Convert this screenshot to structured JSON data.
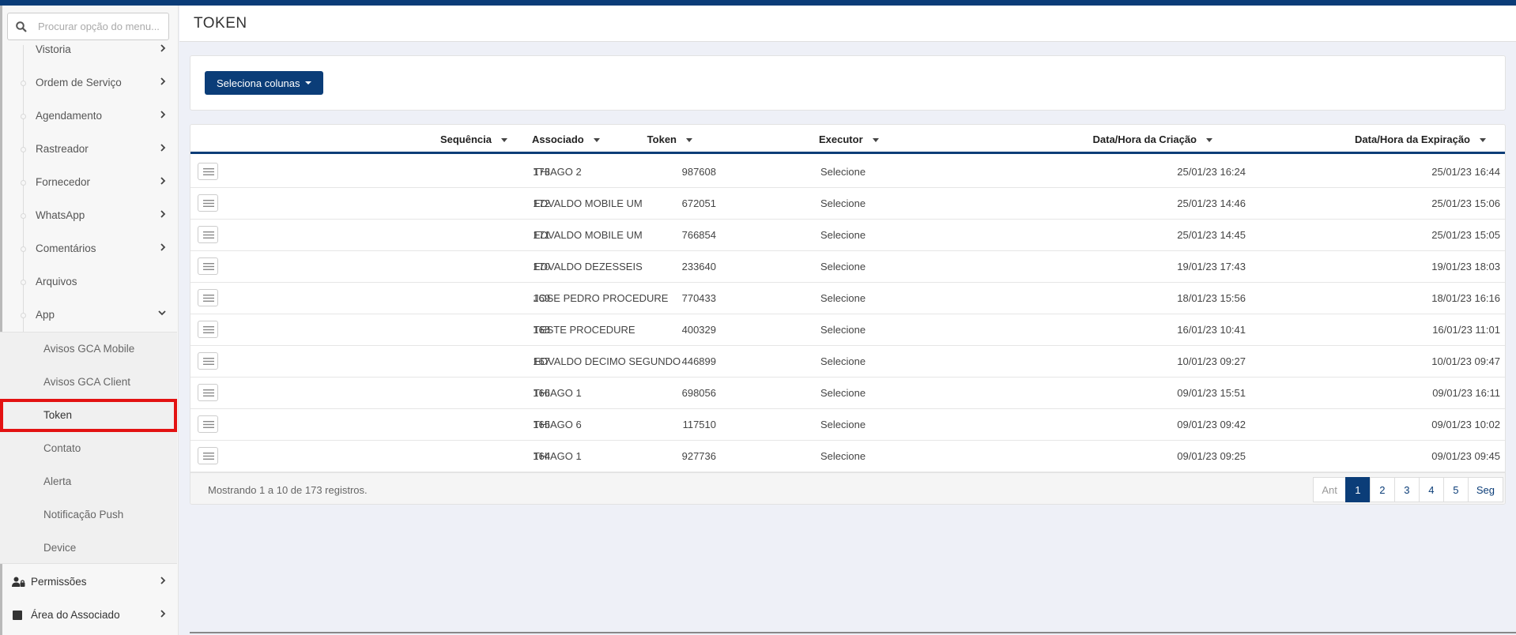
{
  "sidebar": {
    "search_placeholder": "Procurar opção do menu...",
    "items": [
      {
        "label": "Vistoria"
      },
      {
        "label": "Ordem de Serviço"
      },
      {
        "label": "Agendamento"
      },
      {
        "label": "Rastreador"
      },
      {
        "label": "Fornecedor"
      },
      {
        "label": "WhatsApp"
      },
      {
        "label": "Comentários"
      },
      {
        "label": "Arquivos"
      },
      {
        "label": "App"
      }
    ],
    "app_subitems": [
      {
        "label": "Avisos GCA Mobile"
      },
      {
        "label": "Avisos GCA Client"
      },
      {
        "label": "Token"
      },
      {
        "label": "Contato"
      },
      {
        "label": "Alerta"
      },
      {
        "label": "Notificação Push"
      },
      {
        "label": "Device"
      }
    ],
    "main_items": [
      {
        "label": "Permissões",
        "icon": "user-lock-icon"
      },
      {
        "label": "Área do Associado",
        "icon": "square-icon"
      }
    ]
  },
  "header": {
    "title": "TOKEN"
  },
  "toolbar": {
    "columns_button": "Seleciona colunas"
  },
  "table": {
    "headers": {
      "sequencia": "Sequência",
      "token": "Token",
      "associado": "Associado",
      "executor": "Executor",
      "criacao": "Data/Hora da Criação",
      "expiracao": "Data/Hora da Expiração"
    },
    "rows": [
      {
        "seq": "173",
        "token": "987608",
        "associado": "THIAGO 2",
        "executor": "Selecione",
        "criacao": "25/01/23 16:24",
        "expiracao": "25/01/23 16:44"
      },
      {
        "seq": "172",
        "token": "672051",
        "associado": "EDVALDO MOBILE UM",
        "executor": "Selecione",
        "criacao": "25/01/23 14:46",
        "expiracao": "25/01/23 15:06"
      },
      {
        "seq": "171",
        "token": "766854",
        "associado": "EDVALDO MOBILE UM",
        "executor": "Selecione",
        "criacao": "25/01/23 14:45",
        "expiracao": "25/01/23 15:05"
      },
      {
        "seq": "170",
        "token": "233640",
        "associado": "EDVALDO DEZESSEIS",
        "executor": "Selecione",
        "criacao": "19/01/23 17:43",
        "expiracao": "19/01/23 18:03"
      },
      {
        "seq": "169",
        "token": "770433",
        "associado": "JOSE PEDRO PROCEDURE",
        "executor": "Selecione",
        "criacao": "18/01/23 15:56",
        "expiracao": "18/01/23 16:16"
      },
      {
        "seq": "168",
        "token": "400329",
        "associado": "TESTE PROCEDURE",
        "executor": "Selecione",
        "criacao": "16/01/23 10:41",
        "expiracao": "16/01/23 11:01"
      },
      {
        "seq": "167",
        "token": "446899",
        "associado": "EDVALDO DECIMO SEGUNDO",
        "executor": "Selecione",
        "criacao": "10/01/23 09:27",
        "expiracao": "10/01/23 09:47"
      },
      {
        "seq": "166",
        "token": "698056",
        "associado": "THIAGO 1",
        "executor": "Selecione",
        "criacao": "09/01/23 15:51",
        "expiracao": "09/01/23 16:11"
      },
      {
        "seq": "165",
        "token": "117510",
        "associado": "THIAGO 6",
        "executor": "Selecione",
        "criacao": "09/01/23 09:42",
        "expiracao": "09/01/23 10:02"
      },
      {
        "seq": "164",
        "token": "927736",
        "associado": "THIAGO 1",
        "executor": "Selecione",
        "criacao": "09/01/23 09:25",
        "expiracao": "09/01/23 09:45"
      }
    ],
    "footer_info": "Mostrando 1 a 10 de 173 registros.",
    "pagination": {
      "prev": "Ant",
      "pages": [
        "1",
        "2",
        "3",
        "4",
        "5"
      ],
      "next": "Seg",
      "current": "1"
    }
  },
  "colors": {
    "brand": "#0b3d78",
    "highlight": "#e31212"
  }
}
